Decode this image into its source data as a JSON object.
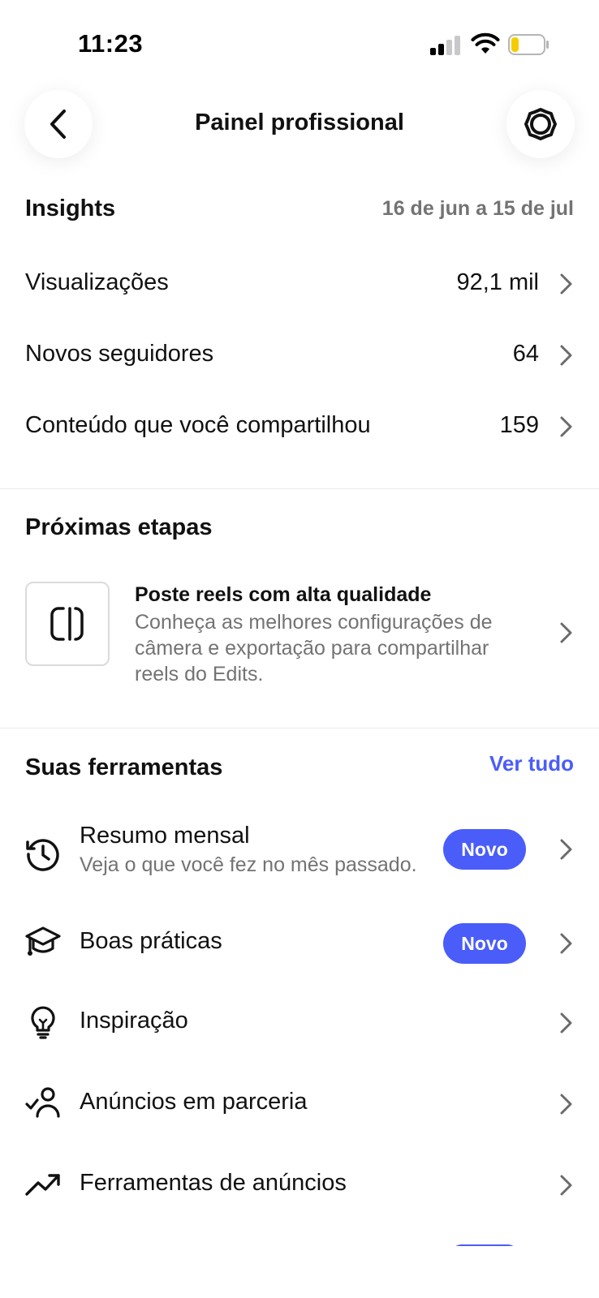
{
  "status_bar": {
    "time": "11:23"
  },
  "header": {
    "title": "Painel profissional",
    "back_icon": "chevron-left-icon",
    "settings_icon": "gear-icon"
  },
  "insights": {
    "title": "Insights",
    "date_range": "16 de jun a 15 de jul",
    "rows": [
      {
        "label": "Visualizações",
        "value": "92,1 mil"
      },
      {
        "label": "Novos seguidores",
        "value": "64"
      },
      {
        "label": "Conteúdo que você compartilhou",
        "value": "159"
      }
    ]
  },
  "next_steps": {
    "title": "Próximas etapas",
    "card": {
      "title": "Poste reels com alta qualidade",
      "description": "Conheça as melhores configurações de câmera e exportação para compartilhar reels do Edits.",
      "icon": "edits-logo-icon"
    }
  },
  "tools": {
    "title": "Suas ferramentas",
    "see_all": "Ver tudo",
    "items": [
      {
        "label": "Resumo mensal",
        "subtitle": "Veja o que você fez no mês passado.",
        "badge": "Novo",
        "icon": "history-clock-icon"
      },
      {
        "label": "Boas práticas",
        "badge": "Novo",
        "icon": "graduation-cap-icon"
      },
      {
        "label": "Inspiração",
        "icon": "lightbulb-icon"
      },
      {
        "label": "Anúncios em parceria",
        "icon": "person-check-icon"
      },
      {
        "label": "Ferramentas de anúncios",
        "icon": "trending-up-icon"
      }
    ]
  },
  "colors": {
    "accent": "#4a5df9",
    "secondary_text": "#737373"
  }
}
